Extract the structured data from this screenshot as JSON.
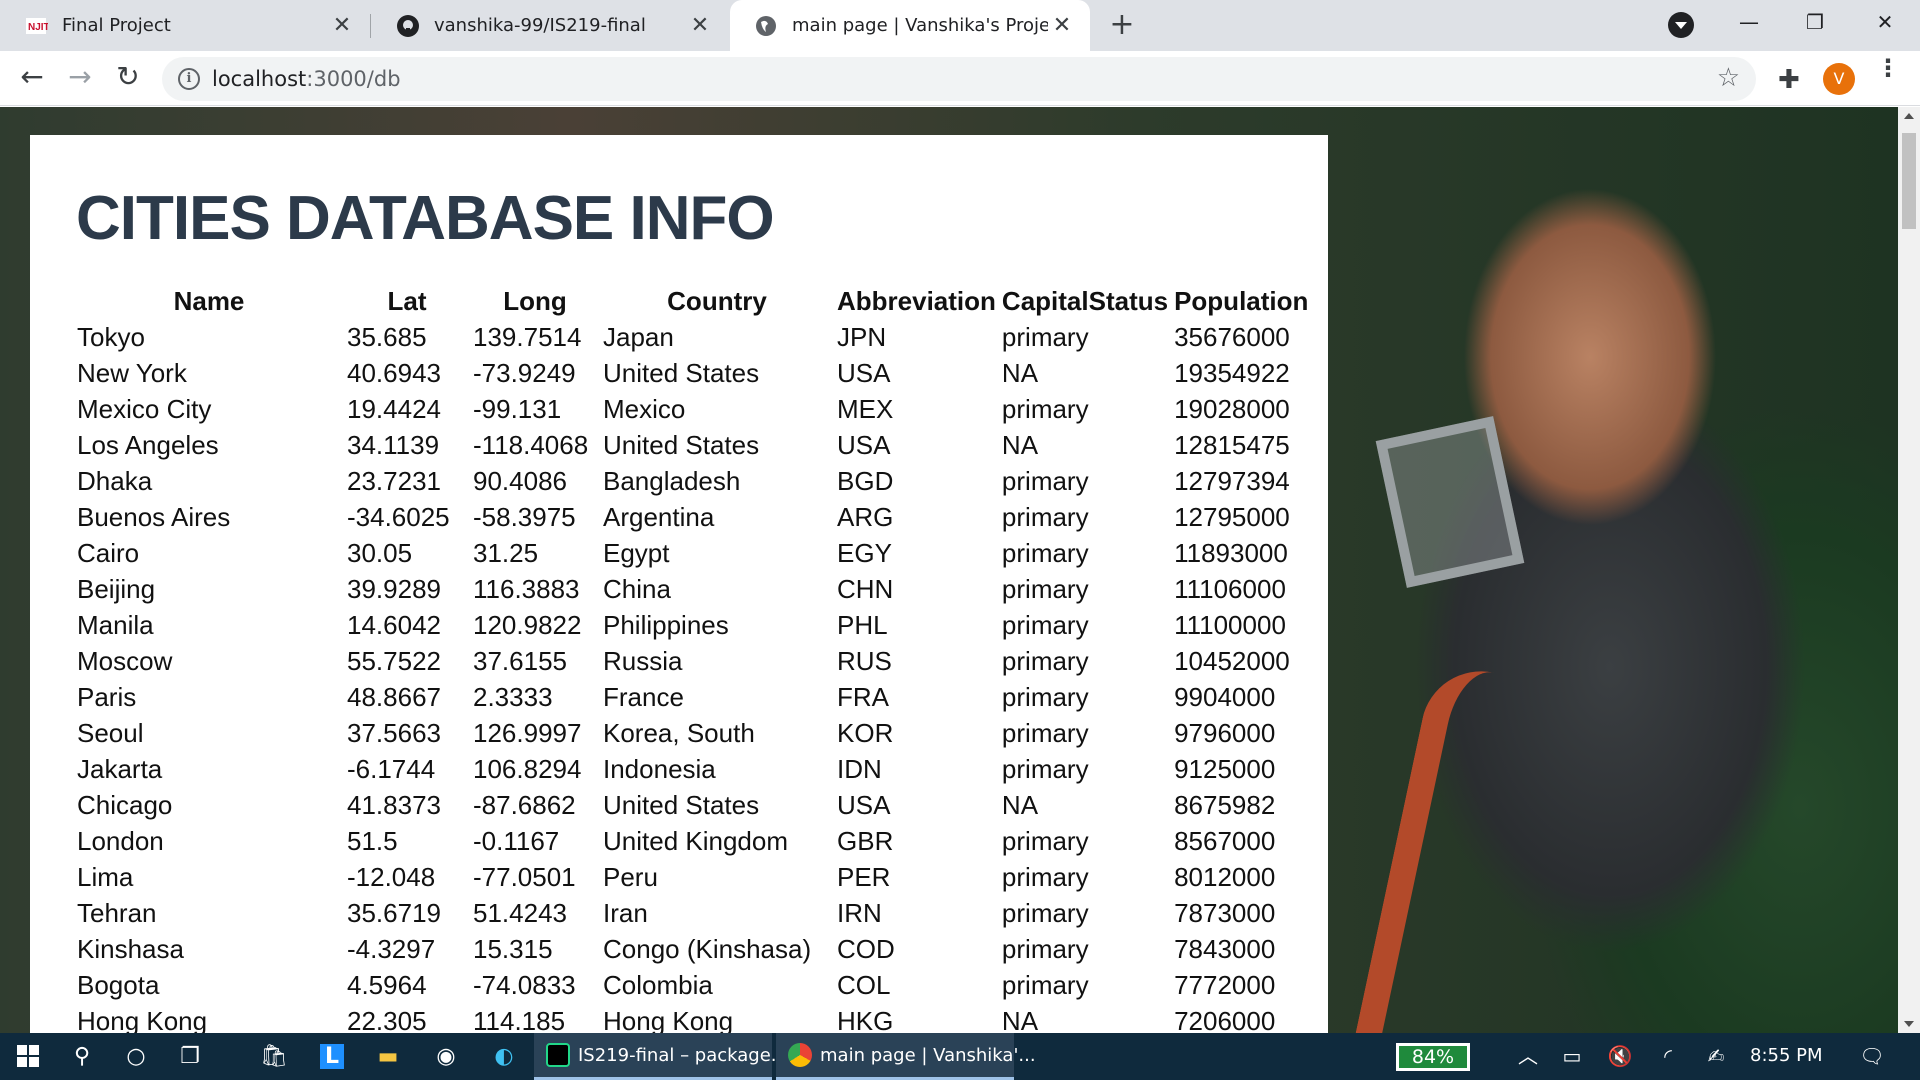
{
  "browser": {
    "tabs": [
      {
        "title": "Final Project"
      },
      {
        "title": "vanshika-99/IS219-final"
      },
      {
        "title": "main page | Vanshika's Project"
      }
    ],
    "url_host": "localhost",
    "url_path": ":3000/db",
    "profile_initial": "V"
  },
  "page": {
    "title": "CITIES DATABASE INFO",
    "columns": [
      "Name",
      "Lat",
      "Long",
      "Country",
      "Abbreviation",
      "CapitalStatus",
      "Population"
    ],
    "rows": [
      [
        "Tokyo",
        "35.685",
        "139.7514",
        "Japan",
        "JPN",
        "primary",
        "35676000"
      ],
      [
        "New York",
        "40.6943",
        "-73.9249",
        "United States",
        "USA",
        "NA",
        "19354922"
      ],
      [
        "Mexico City",
        "19.4424",
        "-99.131",
        "Mexico",
        "MEX",
        "primary",
        "19028000"
      ],
      [
        "Los Angeles",
        "34.1139",
        "-118.4068",
        "United States",
        "USA",
        "NA",
        "12815475"
      ],
      [
        "Dhaka",
        "23.7231",
        "90.4086",
        "Bangladesh",
        "BGD",
        "primary",
        "12797394"
      ],
      [
        "Buenos Aires",
        "-34.6025",
        "-58.3975",
        "Argentina",
        "ARG",
        "primary",
        "12795000"
      ],
      [
        "Cairo",
        "30.05",
        "31.25",
        "Egypt",
        "EGY",
        "primary",
        "11893000"
      ],
      [
        "Beijing",
        "39.9289",
        "116.3883",
        "China",
        "CHN",
        "primary",
        "11106000"
      ],
      [
        "Manila",
        "14.6042",
        "120.9822",
        "Philippines",
        "PHL",
        "primary",
        "11100000"
      ],
      [
        "Moscow",
        "55.7522",
        "37.6155",
        "Russia",
        "RUS",
        "primary",
        "10452000"
      ],
      [
        "Paris",
        "48.8667",
        "2.3333",
        "France",
        "FRA",
        "primary",
        "9904000"
      ],
      [
        "Seoul",
        "37.5663",
        "126.9997",
        "Korea, South",
        "KOR",
        "primary",
        "9796000"
      ],
      [
        "Jakarta",
        "-6.1744",
        "106.8294",
        "Indonesia",
        "IDN",
        "primary",
        "9125000"
      ],
      [
        "Chicago",
        "41.8373",
        "-87.6862",
        "United States",
        "USA",
        "NA",
        "8675982"
      ],
      [
        "London",
        "51.5",
        "-0.1167",
        "United Kingdom",
        "GBR",
        "primary",
        "8567000"
      ],
      [
        "Lima",
        "-12.048",
        "-77.0501",
        "Peru",
        "PER",
        "primary",
        "8012000"
      ],
      [
        "Tehran",
        "35.6719",
        "51.4243",
        "Iran",
        "IRN",
        "primary",
        "7873000"
      ],
      [
        "Kinshasa",
        "-4.3297",
        "15.315",
        "Congo (Kinshasa)",
        "COD",
        "primary",
        "7843000"
      ],
      [
        "Bogota",
        "4.5964",
        "-74.0833",
        "Colombia",
        "COL",
        "primary",
        "7772000"
      ],
      [
        "Hong Kong",
        "22.305",
        "114.185",
        "Hong Kong",
        "HKG",
        "NA",
        "7206000"
      ]
    ]
  },
  "taskbar": {
    "apps": [
      {
        "label": "IS219-final – package...."
      },
      {
        "label": "main page | Vanshika'..."
      }
    ],
    "battery": "84%",
    "time": "8:55 PM"
  },
  "colors": {
    "title": "#2c3a4a",
    "tabstrip": "#dee1e6",
    "taskbar": "#0f2a3d",
    "profile": "#e8710a"
  }
}
